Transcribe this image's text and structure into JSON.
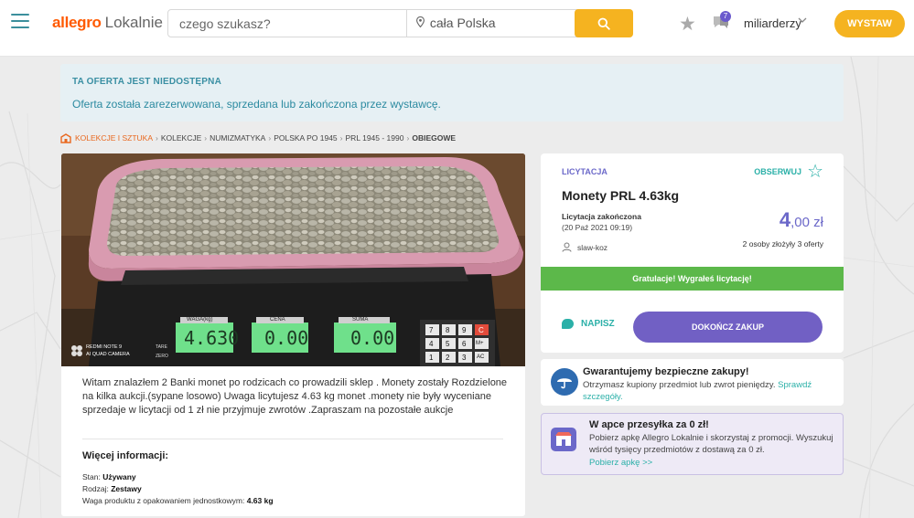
{
  "header": {
    "logo_brand": "allegro",
    "logo_sub": "Lokalnie",
    "search_placeholder": "czego szukasz?",
    "location": "cała Polska",
    "messages_badge": "7",
    "username": "miliarderzy",
    "sell_button": "WYSTAW"
  },
  "notice": {
    "title": "TA OFERTA JEST NIEDOSTĘPNA",
    "text": "Oferta została zarezerwowana, sprzedana lub zakończona przez wystawcę."
  },
  "breadcrumb": [
    "KOLEKCJE I SZTUKA",
    "KOLEKCJE",
    "NUMIZMATYKA",
    "POLSKA PO 1945",
    "PRL 1945 - 1990",
    "OBIEGOWE"
  ],
  "photo": {
    "scale_labels": [
      "WAGA(kg)",
      "CENA",
      "SUMA"
    ],
    "scale_values": [
      "4.630",
      "0.00",
      "0.00"
    ],
    "side_labels": [
      "TARE",
      "ZERO"
    ],
    "keys": [
      "7",
      "8",
      "9",
      "C",
      "4",
      "5",
      "6",
      "M+",
      "1",
      "2",
      "3",
      "AC"
    ],
    "watermark_line1": "REDMI NOTE 9",
    "watermark_line2": "AI QUAD CAMERA"
  },
  "description": {
    "text": "Witam znalazłem 2 Banki monet po rodzicach co prowadzili sklep . Monety zostały Rozdzielone na kilka aukcji.(sypane losowo) Uwaga licytujesz 4.63 kg monet .monety nie były wyceniane sprzedaje w licytacji od 1 zł nie przyjmuje zwrotów .Zapraszam na pozostałe aukcje",
    "more_title": "Więcej informacji:",
    "specs": [
      {
        "label": "Stan:",
        "value": "Używany"
      },
      {
        "label": "Rodzaj:",
        "value": "Zestawy"
      },
      {
        "label": "Waga produktu z opakowaniem jednostkowym:",
        "value": "4.63 kg"
      }
    ]
  },
  "offer": {
    "type_label": "LICYTACJA",
    "observe_label": "OBSERWUJ",
    "title": "Monety PRL 4.63kg",
    "ended_label": "Licytacja zakończona",
    "ended_date": "(20 Paź 2021 09:19)",
    "price_main": "4",
    "price_rest": ",00 zł",
    "bids": "2 osoby złożyły 3 oferty",
    "seller": "slaw-koz",
    "congrats": "Gratulacje! Wygrałeś licytację!",
    "write_label": "NAPISZ",
    "finish_button": "DOKOŃCZ ZAKUP"
  },
  "safe": {
    "title": "Gwarantujemy bezpieczne zakupy!",
    "text": "Otrzymasz kupiony przedmiot lub zwrot pieniędzy.",
    "link": "Sprawdź szczegóły."
  },
  "app_promo": {
    "title": "W apce przesyłka za 0 zł!",
    "text": "Pobierz apkę Allegro Lokalnie i skorzystaj z promocji. Wyszukuj wśród tysięcy przedmiotów z dostawą za 0 zł.",
    "link": "Pobierz apkę >>"
  },
  "colors": {
    "brand_orange": "#ff5a00",
    "accent_yellow": "#f5b320",
    "accent_purple": "#6b68c9",
    "accent_teal": "#2bb0a8",
    "success_green": "#5cb84a"
  }
}
